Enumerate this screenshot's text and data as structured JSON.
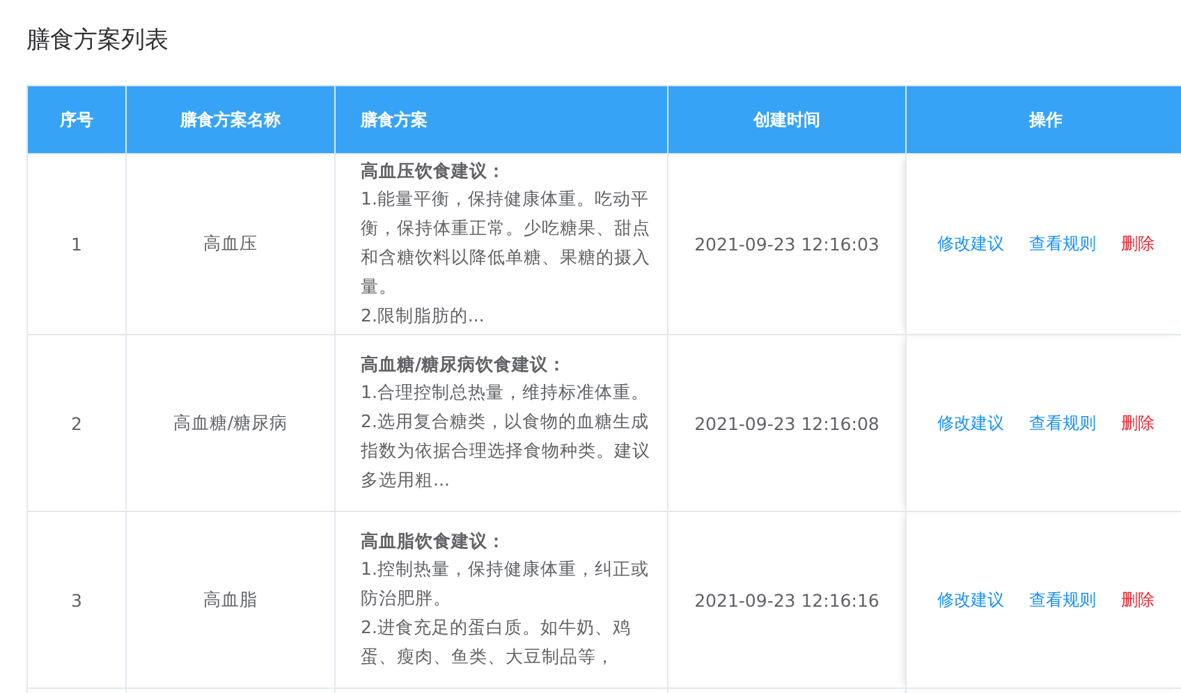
{
  "page": {
    "title": "膳食方案列表"
  },
  "table": {
    "columns": [
      "序号",
      "膳食方案名称",
      "膳食方案",
      "创建时间",
      "操作"
    ],
    "rows": [
      {
        "index": "1",
        "name": "高血压",
        "plan": {
          "heading": "高血压饮食建议：",
          "paragraphs": [
            "1.能量平衡，保持健康体重。吃动平衡，保持体重正常。少吃糖果、甜点和含糖饮料以降低单糖、果糖的摄入量。",
            "2.限制脂肪的..."
          ]
        },
        "created": "2021-09-23 12:16:03",
        "actions": [
          {
            "label": "修改建议",
            "kind": "normal"
          },
          {
            "label": "查看规则",
            "kind": "normal"
          },
          {
            "label": "删除",
            "kind": "danger"
          }
        ]
      },
      {
        "index": "2",
        "name": "高血糖/糖尿病",
        "plan": {
          "heading": "高血糖/糖尿病饮食建议：",
          "paragraphs": [
            "1.合理控制总热量，维持标准体重。",
            "2.选用复合糖类，以食物的血糖生成指数为依据合理选择食物种类。建议多选用粗..."
          ]
        },
        "created": "2021-09-23 12:16:08",
        "actions": [
          {
            "label": "修改建议",
            "kind": "normal"
          },
          {
            "label": "查看规则",
            "kind": "normal"
          },
          {
            "label": "删除",
            "kind": "danger"
          }
        ]
      },
      {
        "index": "3",
        "name": "高血脂",
        "plan": {
          "heading": "高血脂饮食建议：",
          "paragraphs": [
            "1.控制热量，保持健康体重，纠正或防治肥胖。",
            "2.进食充足的蛋白质。如牛奶、鸡蛋、瘦肉、鱼类、大豆制品等，"
          ]
        },
        "created": "2021-09-23 12:16:16",
        "actions": [
          {
            "label": "修改建议",
            "kind": "normal"
          },
          {
            "label": "查看规则",
            "kind": "normal"
          },
          {
            "label": "删除",
            "kind": "danger"
          }
        ]
      }
    ]
  }
}
